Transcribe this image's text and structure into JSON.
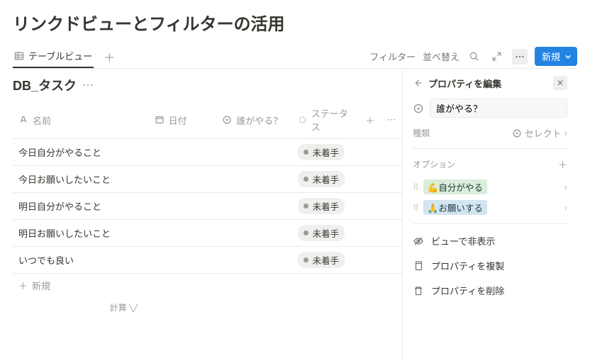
{
  "title": "リンクドビューとフィルターの活用",
  "tab": {
    "label": "テーブルビュー"
  },
  "toolbar": {
    "filter": "フィルター",
    "sort": "並べ替え",
    "new": "新規"
  },
  "db": {
    "title": "DB_タスク",
    "columns": {
      "name": "名前",
      "date": "日付",
      "who": "誰がやる？",
      "status": "ステータス"
    },
    "rows": [
      {
        "name": "今日自分がやること",
        "status": "未着手"
      },
      {
        "name": "今日お願いしたいこと",
        "status": "未着手"
      },
      {
        "name": "明日自分がやること",
        "status": "未着手"
      },
      {
        "name": "明日お願いしたいこと",
        "status": "未着手"
      },
      {
        "name": "いつでも良い",
        "status": "未着手"
      }
    ],
    "addrow": "新規",
    "calc": "計算"
  },
  "panel": {
    "title": "プロパティを編集",
    "prop_name": "誰がやる？",
    "type_label": "種類",
    "type_value": "セレクト",
    "options_label": "オプション",
    "options": [
      {
        "emoji": "💪",
        "label": "自分がやる",
        "cls": "opt-green"
      },
      {
        "emoji": "🙏",
        "label": "お願いする",
        "cls": "opt-blue"
      }
    ],
    "actions": {
      "hide": "ビューで非表示",
      "duplicate": "プロパティを複製",
      "delete": "プロパティを削除"
    }
  }
}
